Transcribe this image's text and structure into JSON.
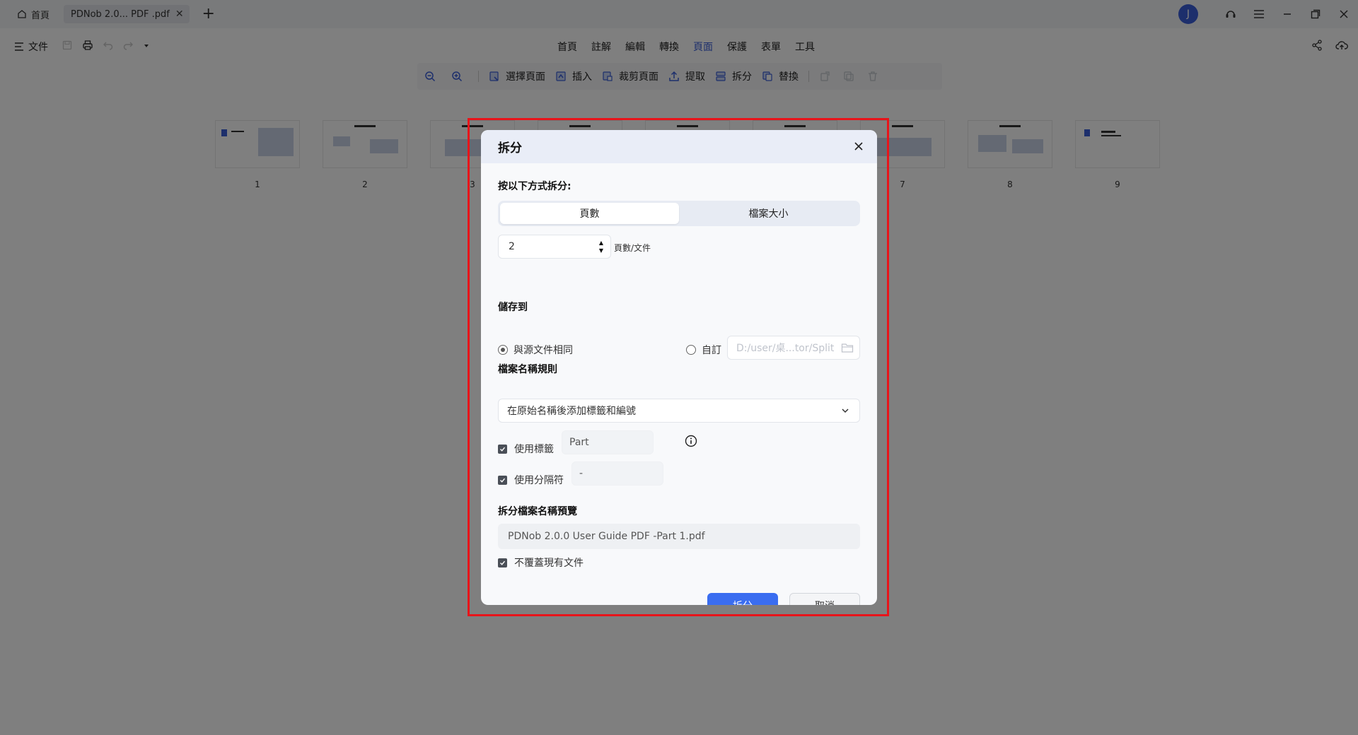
{
  "titlebar": {
    "home_tab": "首頁",
    "doc_tab": "PDNob 2.0... PDF .pdf",
    "avatar_letter": "J"
  },
  "menubar": {
    "file_label": "文件",
    "items": [
      "首頁",
      "註解",
      "編輯",
      "轉換",
      "頁面",
      "保護",
      "表單",
      "工具"
    ],
    "active_item": "頁面"
  },
  "toolbar": {
    "select_pages": "選擇頁面",
    "insert": "插入",
    "crop_pages": "裁剪頁面",
    "extract": "提取",
    "split": "拆分",
    "replace": "替換"
  },
  "thumbnails": [
    "1",
    "2",
    "3",
    "4",
    "5",
    "6",
    "7",
    "8",
    "9"
  ],
  "dialog": {
    "title": "拆分",
    "split_by_label": "按以下方式拆分:",
    "mode_pages": "頁數",
    "mode_size": "檔案大小",
    "pages_value": "2",
    "pages_unit": "頁數/文件",
    "save_to_label": "儲存到",
    "same_as_source": "與源文件相同",
    "custom": "自訂",
    "custom_path_placeholder": "D:/user/桌...tor/Split",
    "naming_rule_label": "檔案名稱規則",
    "naming_rule_value": "在原始名稱後添加標籤和編號",
    "use_label": "使用標籤",
    "label_value": "Part",
    "use_separator": "使用分隔符",
    "separator_value": "-",
    "preview_label": "拆分檔案名稱預覽",
    "preview_value": "PDNob 2.0.0 User Guide PDF -Part 1.pdf",
    "no_overwrite": "不覆蓋現有文件",
    "split_button": "拆分",
    "cancel_button": "取消"
  },
  "colors": {
    "accent": "#3a6df0",
    "highlight_border": "#e8141a"
  }
}
